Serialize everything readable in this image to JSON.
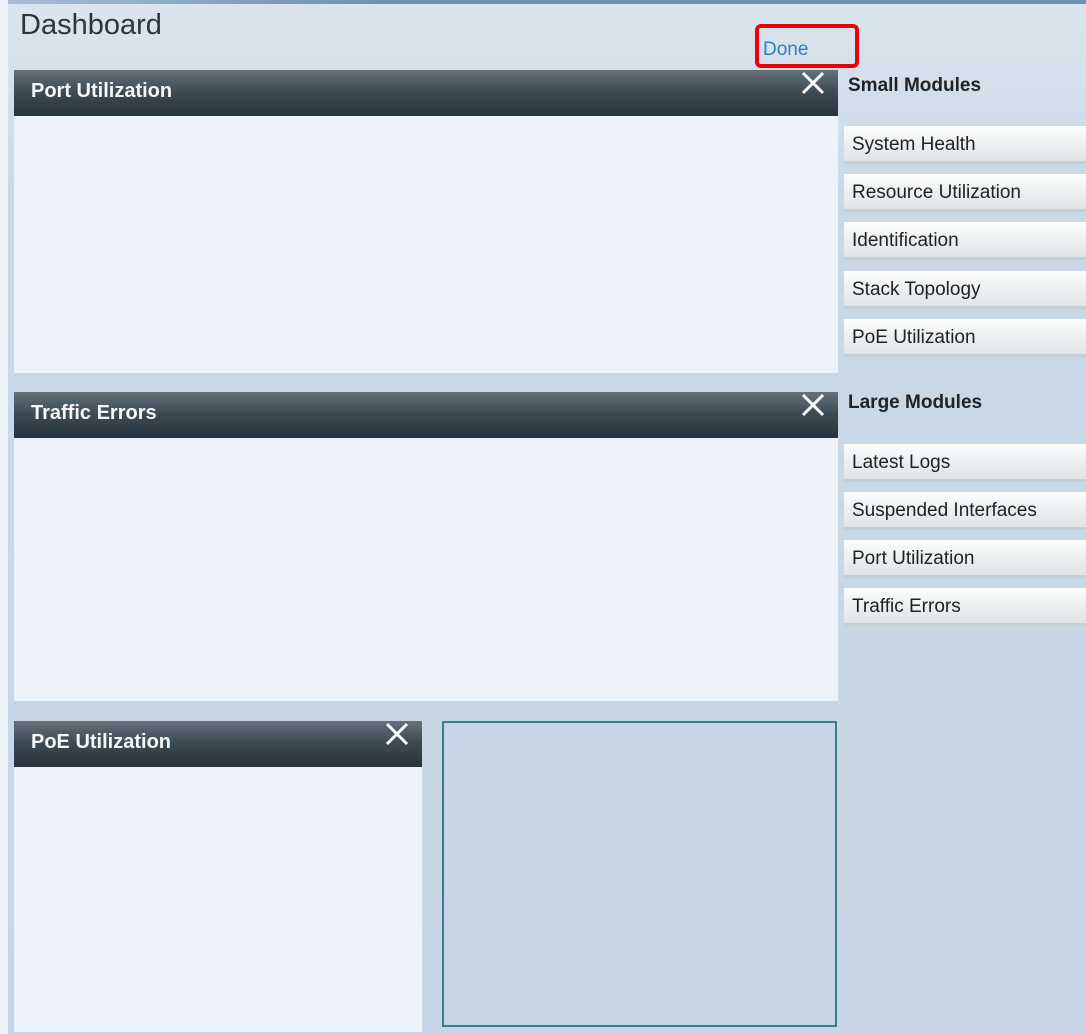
{
  "header": {
    "title": "Dashboard",
    "done_label": "Done"
  },
  "modules": {
    "port_utilization": {
      "title": "Port Utilization"
    },
    "traffic_errors": {
      "title": "Traffic Errors"
    },
    "poe_utilization": {
      "title": "PoE Utilization"
    }
  },
  "sidebar": {
    "small_heading": "Small Modules",
    "small_items": [
      "System Health",
      "Resource Utilization",
      "Identification",
      "Stack Topology",
      "PoE Utilization"
    ],
    "large_heading": "Large Modules",
    "large_items": [
      "Latest Logs",
      "Suspended Interfaces",
      "Port Utilization",
      "Traffic Errors"
    ]
  },
  "colors": {
    "accent_link": "#2f7ec4",
    "highlight_border": "#e8000a",
    "module_header": "#3c4a53"
  },
  "icons": {
    "close": "close-icon"
  }
}
